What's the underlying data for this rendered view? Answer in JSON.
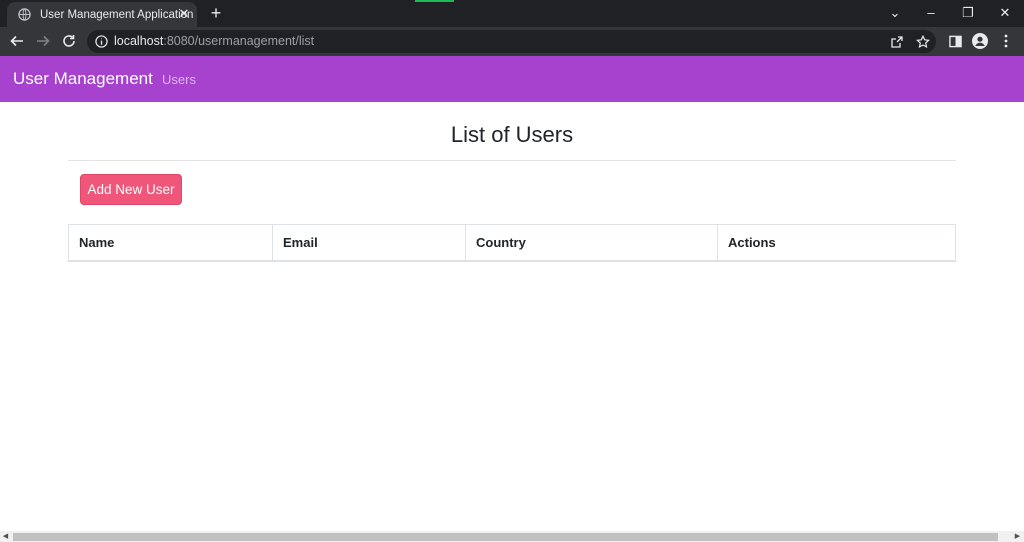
{
  "browser": {
    "tab_title": "User Management Application",
    "tab_close_glyph": "✕",
    "new_tab_glyph": "+",
    "url_host": "localhost",
    "url_rest": ":8080/usermanagement/list",
    "window_controls": {
      "dropdown": "⌄",
      "minimize": "–",
      "restore": "❐",
      "close": "✕"
    },
    "icons": [
      "globe-icon",
      "back-arrow-icon",
      "forward-arrow-icon",
      "reload-icon",
      "info-icon",
      "share-icon",
      "bookmark-star-icon",
      "side-panel-icon",
      "profile-icon",
      "menu-dots-icon"
    ]
  },
  "navbar": {
    "brand": "User Management",
    "link_users": "Users",
    "background": "#a742cf"
  },
  "main": {
    "title": "List of Users",
    "add_button_label": "Add New User",
    "add_button_color": "#f0567a",
    "table": {
      "columns": [
        "Name",
        "Email",
        "Country",
        "Actions"
      ],
      "rows": []
    }
  },
  "scrollbar": {
    "left_arrow": "◀",
    "right_arrow": "▶"
  }
}
